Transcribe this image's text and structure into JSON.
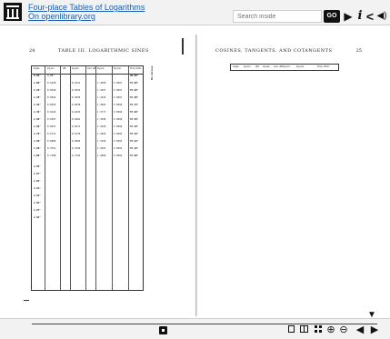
{
  "header": {
    "book_title": "Four-place Tables of Logarithms",
    "source_link": "On openlibrary.org",
    "search_placeholder": "Search inside",
    "go_label": "GO",
    "icons": [
      "library-logo-icon",
      "play-icon",
      "info-icon",
      "share-icon",
      "audio-icon"
    ]
  },
  "left_page": {
    "page_number": "24",
    "title": "TABLE III.  LOGARITHMIC SINES",
    "table_headers": [
      "Angle",
      "log sin",
      "diff.",
      "log tan",
      "com. diff.",
      "log cot",
      "log cos",
      "Prop. Parts"
    ],
    "rotated_label": "Do not use",
    "rows": [
      [
        "0.00°",
        "0.00°",
        "",
        "",
        "",
        "",
        "",
        "90.00°"
      ],
      [
        "2.00°",
        "8.5428",
        "",
        "8.5431",
        "",
        "1.4569",
        "9.9997",
        "87.00°"
      ],
      [
        "2.10°",
        "8.5640",
        "",
        "8.5643",
        "",
        "1.4357",
        "9.9997",
        "87.90°"
      ],
      [
        "2.20°",
        "8.5842",
        "",
        "8.5845",
        "",
        "1.4155",
        "9.9997",
        "87.80°"
      ],
      [
        "2.30°",
        "8.6035",
        "",
        "8.6038",
        "",
        "1.3962",
        "9.9996",
        "87.70°"
      ],
      [
        "2.40°",
        "8.6220",
        "",
        "8.6223",
        "",
        "1.3777",
        "9.9996",
        "87.60°"
      ],
      [
        "2.50°",
        "8.6397",
        "",
        "8.6401",
        "",
        "1.3599",
        "9.9996",
        "87.50°"
      ],
      [
        "2.60°",
        "8.6567",
        "",
        "8.6571",
        "",
        "1.3429",
        "9.9996",
        "87.40°"
      ],
      [
        "2.70°",
        "8.6731",
        "",
        "8.6736",
        "",
        "1.3264",
        "9.9995",
        "87.30°"
      ],
      [
        "2.80°",
        "8.6889",
        "",
        "8.6894",
        "",
        "1.3106",
        "9.9995",
        "87.20°"
      ],
      [
        "2.90°",
        "8.7041",
        "",
        "8.7046",
        "",
        "1.2954",
        "9.9994",
        "87.10°"
      ],
      [
        "3.00°",
        "8.7188",
        "",
        "8.7194",
        "",
        "1.2806",
        "9.9994",
        "87.00°"
      ]
    ],
    "continuation_angles": [
      "2.85°",
      "2.87°",
      "2.89°",
      "2.91°",
      "2.93°",
      "2.95°",
      "2.97°",
      "2.99°"
    ]
  },
  "right_page": {
    "page_number": "25",
    "title": "COSINES, TANGENTS, AND COTANGENTS",
    "table_headers": [
      "Angle",
      "log sin",
      "diff.",
      "log tan",
      "com. diff.",
      "log cot",
      "log cos",
      "Prop. Parts"
    ]
  },
  "navbar": {
    "progress_fraction": 0.38,
    "icons": [
      "collapse-arrow-icon",
      "one-page-view-icon",
      "two-page-view-icon",
      "thumbnail-view-icon",
      "zoom-in-icon",
      "zoom-out-icon",
      "previous-page-icon",
      "next-page-icon"
    ]
  }
}
